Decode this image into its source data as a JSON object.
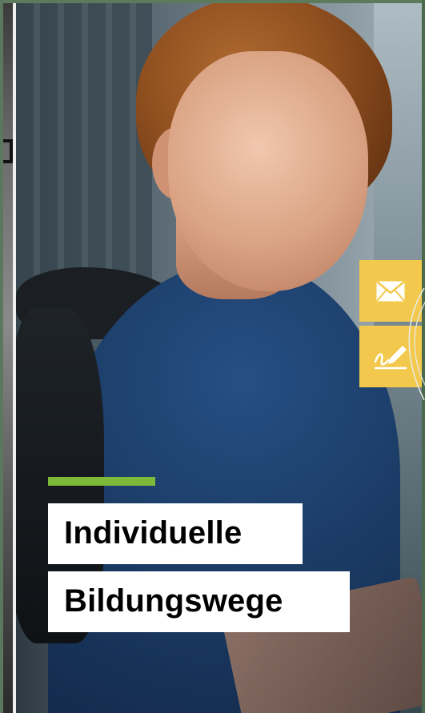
{
  "hero": {
    "headline_line1": "Individuelle",
    "headline_line2": "Bildungswege"
  },
  "side_buttons": [
    {
      "icon": "mail-icon"
    },
    {
      "icon": "signature-pen-icon"
    }
  ],
  "colors": {
    "accent_green": "#7dba3a",
    "button_yellow": "#f2c94c",
    "headline_bg": "#ffffff",
    "headline_text": "#000000"
  }
}
